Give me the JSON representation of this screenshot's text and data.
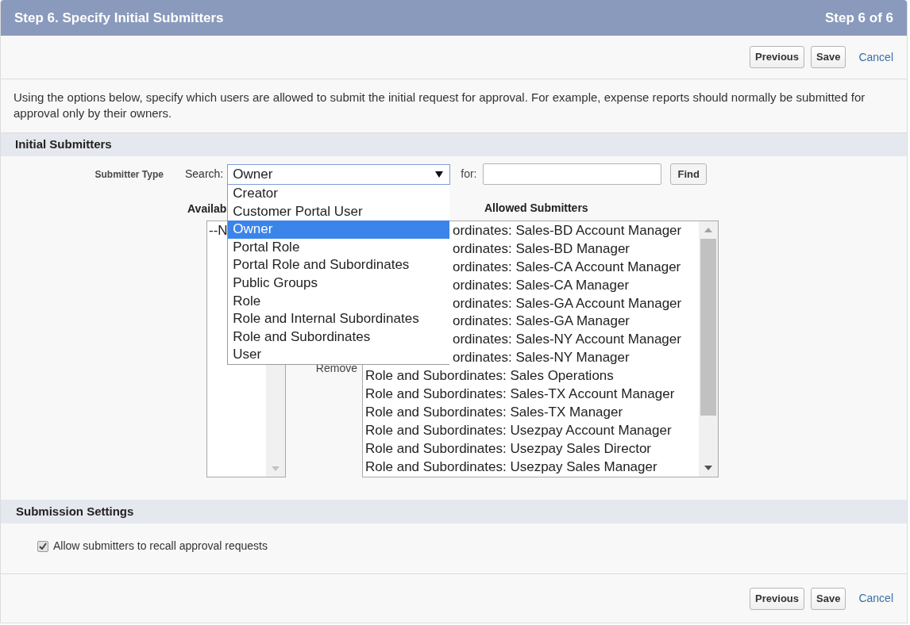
{
  "header": {
    "title": "Step 6. Specify Initial Submitters",
    "step": "Step 6 of 6"
  },
  "top_actions": [
    {
      "kind": "button",
      "label": "Previous"
    },
    {
      "kind": "button",
      "label": "Save"
    },
    {
      "kind": "link",
      "label": "Cancel"
    }
  ],
  "description": "Using the options below, specify which users are allowed to submit the initial request for approval. For example, expense reports should normally be submitted for approval only by their owners.",
  "initial_submitters": {
    "title": "Initial Submitters",
    "submitter_type_label": "Submitter Type",
    "search_label": "Search:",
    "search_select": {
      "value": "Owner",
      "expanded": true,
      "options": [
        {
          "label": "Creator",
          "selected": false
        },
        {
          "label": "Customer Portal User",
          "selected": false
        },
        {
          "label": "Owner",
          "selected": true
        },
        {
          "label": "Portal Role",
          "selected": false
        },
        {
          "label": "Portal Role and Subordinates",
          "selected": false
        },
        {
          "label": "Public Groups",
          "selected": false
        },
        {
          "label": "Role",
          "selected": false
        },
        {
          "label": "Role and Internal Subordinates",
          "selected": false
        },
        {
          "label": "Role and Subordinates",
          "selected": false
        },
        {
          "label": "User",
          "selected": false
        }
      ]
    },
    "for_label": "for:",
    "find_button": "Find",
    "available": {
      "label": "Availab",
      "items": [
        "--N"
      ]
    },
    "remove_button": "Remove",
    "allowed": {
      "label": "Allowed Submitters",
      "items": [
        {
          "kind": "covered",
          "text": "ordinates: Sales-BD Account Manager"
        },
        {
          "kind": "covered",
          "text": "ordinates: Sales-BD Manager"
        },
        {
          "kind": "covered",
          "text": "ordinates: Sales-CA Account Manager"
        },
        {
          "kind": "covered",
          "text": "ordinates: Sales-CA Manager"
        },
        {
          "kind": "covered",
          "text": "ordinates: Sales-GA Account Manager"
        },
        {
          "kind": "covered",
          "text": "ordinates: Sales-GA Manager"
        },
        {
          "kind": "covered",
          "text": "ordinates: Sales-NY Account Manager"
        },
        {
          "kind": "covered",
          "text": "ordinates: Sales-NY Manager"
        },
        {
          "kind": "full",
          "text": "Role and Subordinates: Sales Operations"
        },
        {
          "kind": "full",
          "text": "Role and Subordinates: Sales-TX Account Manager"
        },
        {
          "kind": "full",
          "text": "Role and Subordinates: Sales-TX Manager"
        },
        {
          "kind": "full",
          "text": "Role and Subordinates: Usezpay Account Manager"
        },
        {
          "kind": "full",
          "text": "Role and Subordinates: Usezpay Sales Director"
        },
        {
          "kind": "full",
          "text": "Role and Subordinates: Usezpay Sales Manager"
        }
      ]
    }
  },
  "submission_settings": {
    "title": "Submission Settings",
    "options": [
      {
        "label": "Allow submitters to recall approval requests",
        "checked": true
      }
    ]
  },
  "bottom_actions": [
    {
      "kind": "button",
      "label": "Previous"
    },
    {
      "kind": "button",
      "label": "Save"
    },
    {
      "kind": "link",
      "label": "Cancel"
    }
  ]
}
